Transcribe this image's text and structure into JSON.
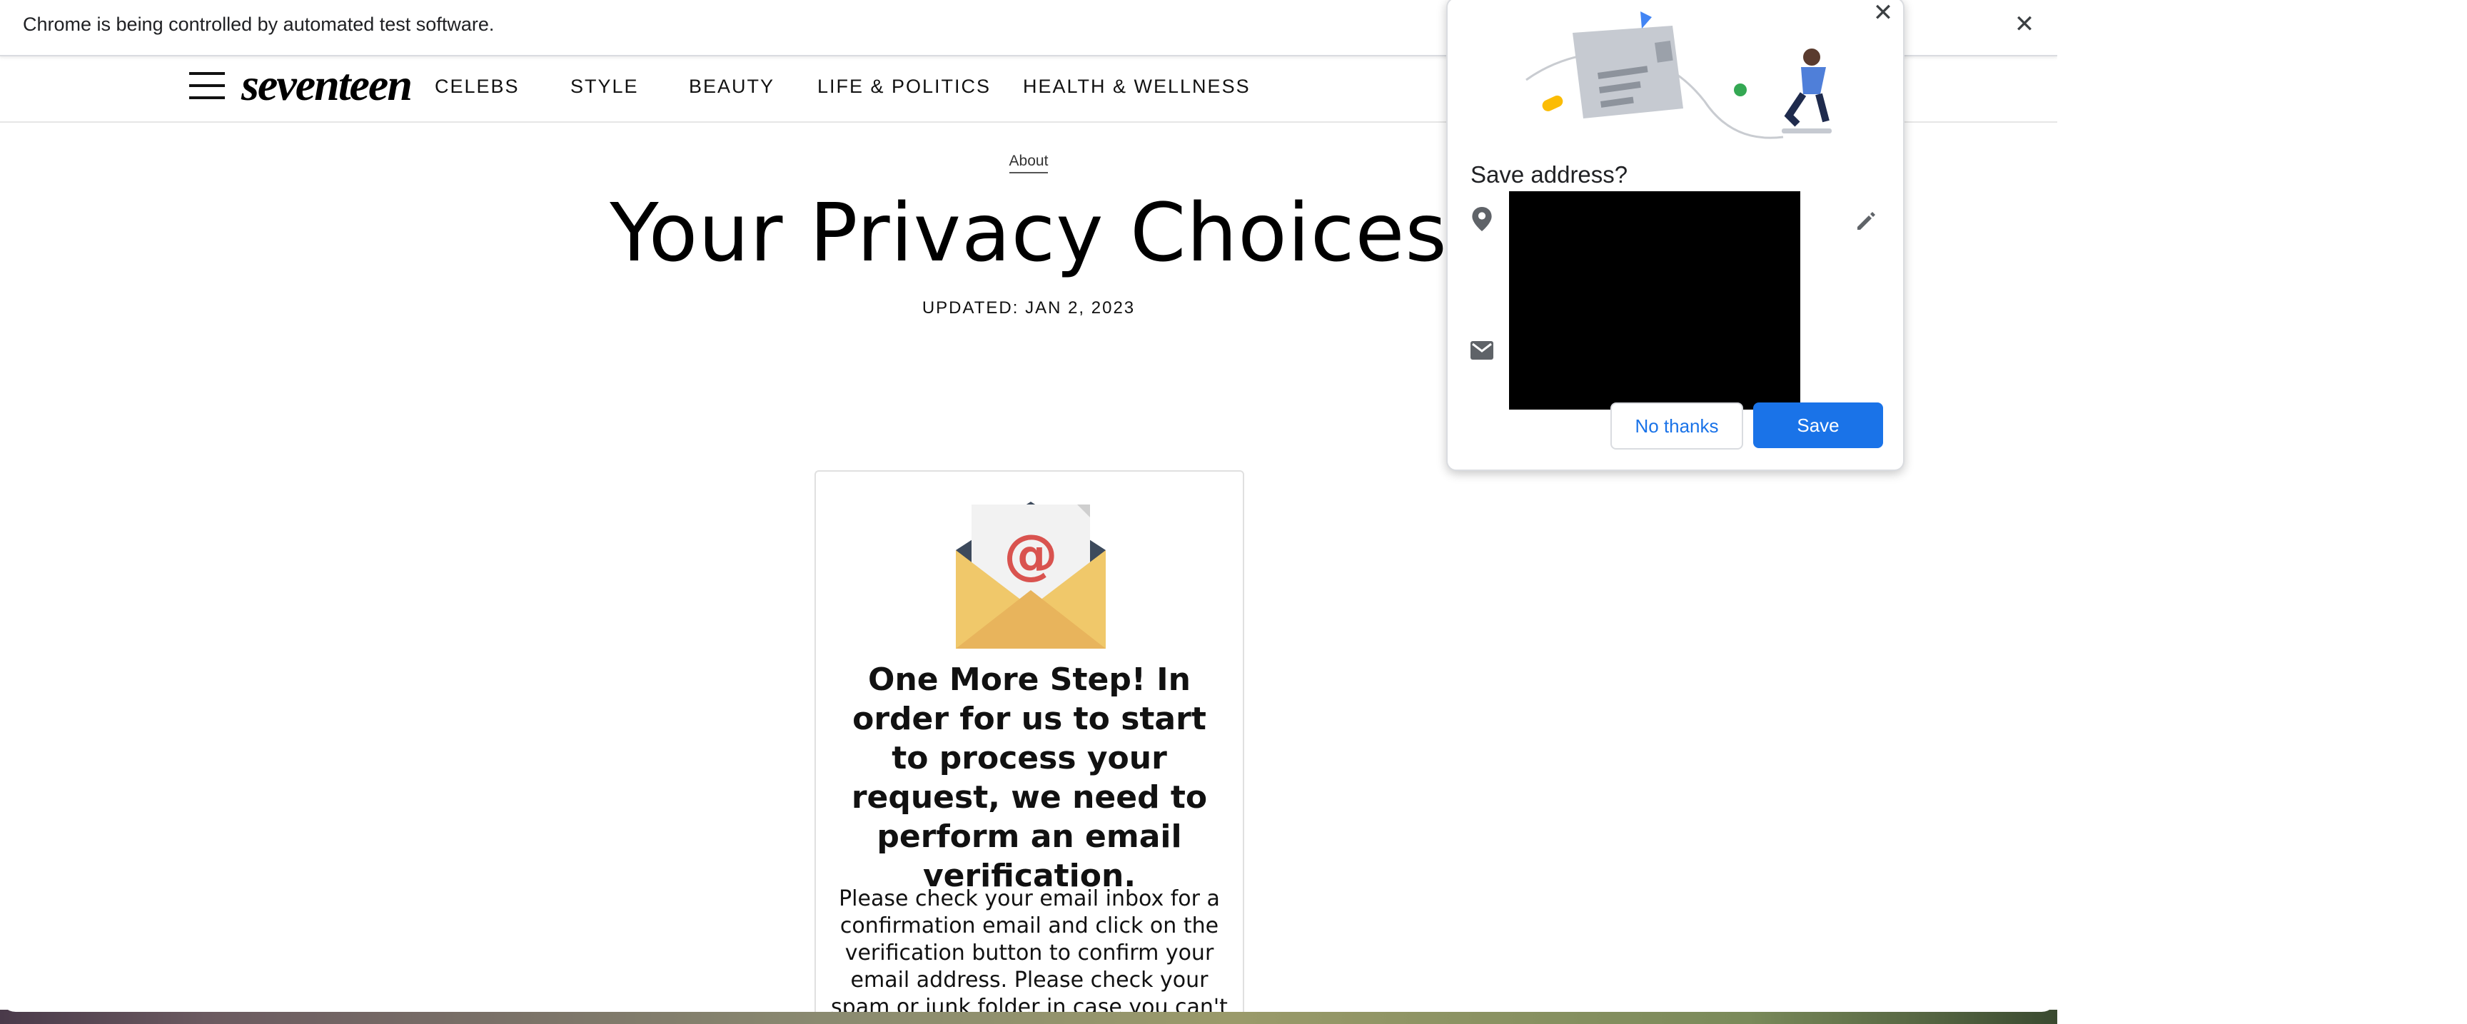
{
  "infobar": {
    "message": "Chrome is being controlled by automated test software.",
    "close_glyph": "✕"
  },
  "site": {
    "logo": "seventeen",
    "nav": [
      "CELEBS",
      "STYLE",
      "BEAUTY",
      "LIFE & POLITICS",
      "HEALTH & WELLNESS"
    ]
  },
  "article": {
    "eyebrow": "About",
    "title": "Your Privacy Choices",
    "updated": "UPDATED: JAN 2, 2023"
  },
  "card": {
    "icon": "email-envelope-icon",
    "heading": "One More Step! In order for us to start to process your request, we need to perform an email verification.",
    "body": "Please check your email inbox for a confirmation email and click on the verification button to confirm your email address. Please check your spam or junk folder in case you can't see the verification"
  },
  "save_address": {
    "title": "Save address?",
    "close_glyph": "✕",
    "no_thanks": "No thanks",
    "save": "Save",
    "accent": "#1a73e8"
  }
}
